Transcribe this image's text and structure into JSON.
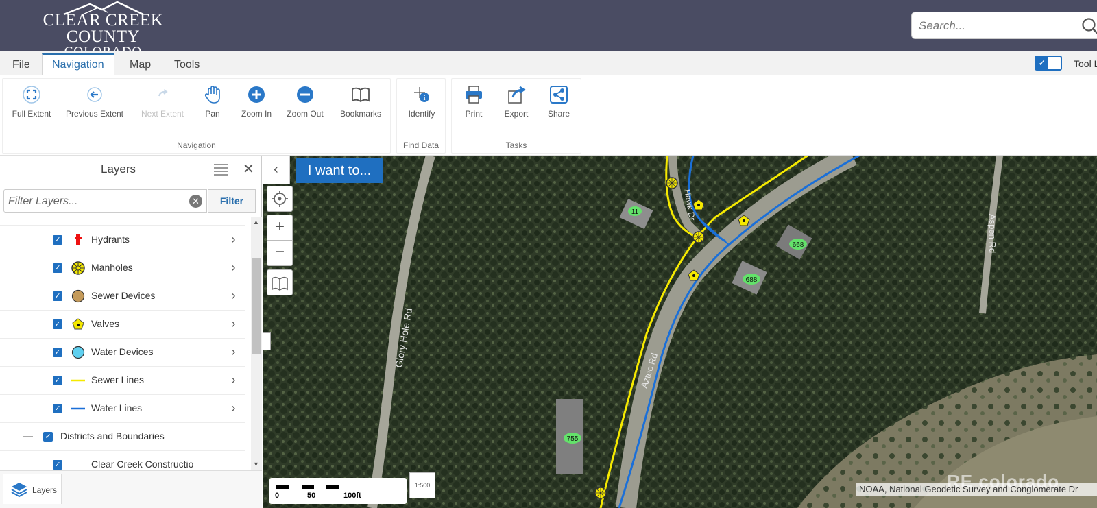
{
  "header": {
    "logo_line1": "CLEAR CREEK COUNTY",
    "logo_line2": "COLORADO",
    "search_placeholder": "Search..."
  },
  "menu": {
    "tabs": [
      {
        "label": "File"
      },
      {
        "label": "Navigation",
        "active": true
      },
      {
        "label": "Map"
      },
      {
        "label": "Tools"
      }
    ],
    "toggle_label": "Tool L",
    "toggle_checked": true
  },
  "ribbon": {
    "groups": [
      {
        "label": "Navigation",
        "buttons": [
          {
            "label": "Full Extent",
            "icon": "full-extent-icon"
          },
          {
            "label": "Previous Extent",
            "icon": "previous-extent-icon"
          },
          {
            "label": "Next Extent",
            "icon": "next-extent-icon",
            "disabled": true
          },
          {
            "label": "Pan",
            "icon": "pan-hand-icon"
          },
          {
            "label": "Zoom In",
            "icon": "zoom-in-icon"
          },
          {
            "label": "Zoom Out",
            "icon": "zoom-out-icon"
          },
          {
            "label": "Bookmarks",
            "icon": "bookmark-book-icon"
          }
        ]
      },
      {
        "label": "Find Data",
        "buttons": [
          {
            "label": "Identify",
            "icon": "identify-icon"
          }
        ]
      },
      {
        "label": "Tasks",
        "buttons": [
          {
            "label": "Print",
            "icon": "printer-icon"
          },
          {
            "label": "Export",
            "icon": "export-icon"
          },
          {
            "label": "Share",
            "icon": "share-icon"
          }
        ]
      }
    ]
  },
  "layers_panel": {
    "title": "Layers",
    "filter_placeholder": "Filter Layers...",
    "filter_button": "Filter",
    "items": [
      {
        "label": "Hydrants",
        "symbol": "hydrant-icon",
        "checked": true
      },
      {
        "label": "Manholes",
        "symbol": "manhole-icon",
        "checked": true
      },
      {
        "label": "Sewer Devices",
        "symbol": "sewer-device-icon",
        "checked": true
      },
      {
        "label": "Valves",
        "symbol": "valve-icon",
        "checked": true
      },
      {
        "label": "Water Devices",
        "symbol": "water-device-icon",
        "checked": true
      },
      {
        "label": "Sewer Lines",
        "symbol": "sewer-line-icon",
        "checked": true
      },
      {
        "label": "Water Lines",
        "symbol": "water-line-icon",
        "checked": true
      },
      {
        "label": "Districts and Boundaries",
        "checked": true,
        "group": true
      },
      {
        "label": "Clear Creek Constructio",
        "checked": true
      }
    ],
    "footer_tab": "Layers"
  },
  "map": {
    "i_want_to": "I want to...",
    "scale_labels": [
      "0",
      "50",
      "100ft"
    ],
    "scale_button": "1:500",
    "attribution": "NOAA, National Geodetic Survey and Conglomerate Dr",
    "watermark": "RE colorado",
    "road_labels": [
      "Glory Hole Rd",
      "Aztec Rd",
      "Aspen Rd",
      "Hawk Dr"
    ],
    "parcel_labels": [
      "11",
      "668",
      "688",
      "755"
    ],
    "colors": {
      "sewer_line": "#f5e900",
      "water_line": "#1a6fd8",
      "accent": "#1f6fc0",
      "header": "#4a4c63"
    }
  }
}
